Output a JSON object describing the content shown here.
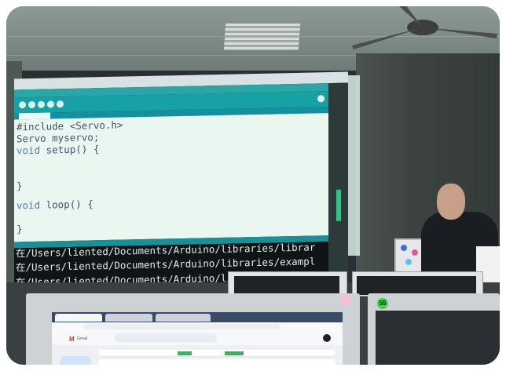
{
  "code_lines": [
    {
      "pre": "#include <Servo.h>",
      "kw": "",
      "post": ""
    },
    {
      "pre": "Servo myservo;",
      "kw": "",
      "post": ""
    },
    {
      "pre": "",
      "kw": "void",
      "post": " setup() {"
    },
    {
      "pre": "",
      "kw": "",
      "post": ""
    },
    {
      "pre": "",
      "kw": "",
      "post": ""
    },
    {
      "pre": "}",
      "kw": "",
      "post": ""
    },
    {
      "pre": "",
      "kw": "",
      "post": ""
    },
    {
      "pre": "",
      "kw": "void",
      "post": " loop() {"
    },
    {
      "pre": "",
      "kw": "",
      "post": ""
    },
    {
      "pre": "}",
      "kw": "",
      "post": ""
    }
  ],
  "console_lines": [
    "在/Users/liented/Documents/Arduino/libraries/librar",
    "在/Users/liented/Documents/Arduino/libraries/exampl",
    "在/Users/liented/Documents/Arduino/libraries/librar"
  ],
  "badge_number": "55",
  "gmail": {
    "brand": "M",
    "label": "Gmail"
  },
  "colors": {
    "ide_teal": "#17a1a5",
    "editor_bg": "#eaf7f1",
    "console_bg": "#0f1416",
    "badge_green": "#3fd14a"
  }
}
